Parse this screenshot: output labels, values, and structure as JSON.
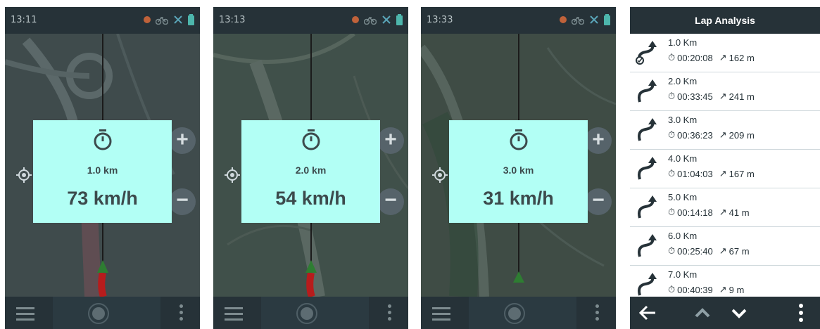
{
  "screens": [
    {
      "time": "13:11",
      "distance": "1.0 km",
      "speed": "73 km/h"
    },
    {
      "time": "13:13",
      "distance": "2.0 km",
      "speed": "54 km/h"
    },
    {
      "time": "13:33",
      "distance": "3.0 km",
      "speed": "31 km/h"
    }
  ],
  "zoom": {
    "plus": "+",
    "minus": "−"
  },
  "lap_analysis": {
    "title": "Lap Analysis",
    "laps": [
      {
        "distance": "1.0 Km",
        "time": "00:20:08",
        "ascent": "162 m"
      },
      {
        "distance": "2.0 Km",
        "time": "00:33:45",
        "ascent": "241 m"
      },
      {
        "distance": "3.0 Km",
        "time": "00:36:23",
        "ascent": "209 m"
      },
      {
        "distance": "4.0 Km",
        "time": "01:04:03",
        "ascent": "167 m"
      },
      {
        "distance": "5.0 Km",
        "time": "00:14:18",
        "ascent": "41 m"
      },
      {
        "distance": "6.0 Km",
        "time": "00:25:40",
        "ascent": "67 m"
      },
      {
        "distance": "7.0 Km",
        "time": "00:40:39",
        "ascent": "9 m"
      }
    ]
  },
  "icons": {
    "status": [
      "gps-dot-icon",
      "bike-icon",
      "no-sensor-icon",
      "battery-icon"
    ],
    "bottom": [
      "menu-icon",
      "record-icon",
      "more-icon"
    ],
    "lap_bottom": [
      "back-arrow-icon",
      "scroll-up-icon",
      "scroll-down-icon",
      "more-icon"
    ]
  },
  "colors": {
    "alert_bg": "#b2fff5",
    "statusbar": "#263238",
    "route": "#b71c1c",
    "position_arrow": "#2e7d32"
  }
}
